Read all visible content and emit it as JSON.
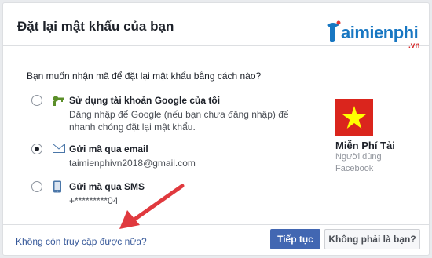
{
  "dialog": {
    "title": "Đặt lại mật khẩu của bạn",
    "question": "Bạn muốn nhận mã để đặt lại mật khẩu bằng cách nào?"
  },
  "brand": {
    "name": "aimienphi",
    "sub": ".vn",
    "color": "#1877c2"
  },
  "options": [
    {
      "title": "Sử dụng tài khoản Google của tôi",
      "desc": "Đăng nhập để Google (nếu bạn chưa đăng nhập) để nhanh chóng đặt lại mật khẩu.",
      "icon": "google-key-icon",
      "selected": false
    },
    {
      "title": "Gửi mã qua email",
      "desc": "taimienphivn2018@gmail.com",
      "icon": "envelope-icon",
      "selected": true
    },
    {
      "title": "Gửi mã qua SMS",
      "desc": "+*********04",
      "icon": "phone-icon",
      "selected": false
    }
  ],
  "profile": {
    "name": "Miễn Phí Tải",
    "sub1": "Người dùng",
    "sub2": "Facebook"
  },
  "footer": {
    "no_access": "Không còn truy cập được nữa?",
    "continue": "Tiếp tục",
    "not_you": "Không phải là bạn?"
  },
  "colors": {
    "primary": "#4267b2",
    "link": "#365899",
    "arrow": "#e0393e"
  }
}
